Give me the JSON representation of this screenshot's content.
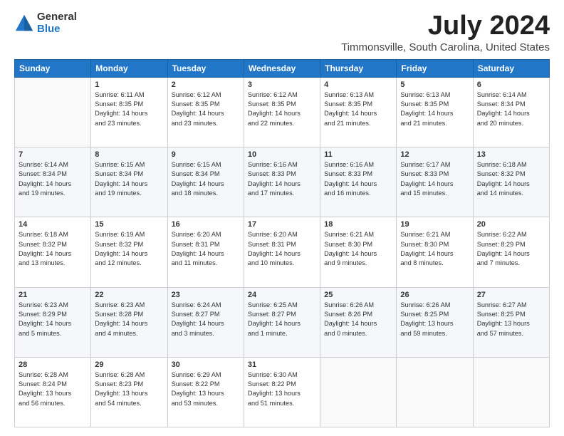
{
  "logo": {
    "general": "General",
    "blue": "Blue"
  },
  "title": "July 2024",
  "subtitle": "Timmonsville, South Carolina, United States",
  "days_header": [
    "Sunday",
    "Monday",
    "Tuesday",
    "Wednesday",
    "Thursday",
    "Friday",
    "Saturday"
  ],
  "weeks": [
    [
      {
        "num": "",
        "info": ""
      },
      {
        "num": "1",
        "info": "Sunrise: 6:11 AM\nSunset: 8:35 PM\nDaylight: 14 hours\nand 23 minutes."
      },
      {
        "num": "2",
        "info": "Sunrise: 6:12 AM\nSunset: 8:35 PM\nDaylight: 14 hours\nand 23 minutes."
      },
      {
        "num": "3",
        "info": "Sunrise: 6:12 AM\nSunset: 8:35 PM\nDaylight: 14 hours\nand 22 minutes."
      },
      {
        "num": "4",
        "info": "Sunrise: 6:13 AM\nSunset: 8:35 PM\nDaylight: 14 hours\nand 21 minutes."
      },
      {
        "num": "5",
        "info": "Sunrise: 6:13 AM\nSunset: 8:35 PM\nDaylight: 14 hours\nand 21 minutes."
      },
      {
        "num": "6",
        "info": "Sunrise: 6:14 AM\nSunset: 8:34 PM\nDaylight: 14 hours\nand 20 minutes."
      }
    ],
    [
      {
        "num": "7",
        "info": "Sunrise: 6:14 AM\nSunset: 8:34 PM\nDaylight: 14 hours\nand 19 minutes."
      },
      {
        "num": "8",
        "info": "Sunrise: 6:15 AM\nSunset: 8:34 PM\nDaylight: 14 hours\nand 19 minutes."
      },
      {
        "num": "9",
        "info": "Sunrise: 6:15 AM\nSunset: 8:34 PM\nDaylight: 14 hours\nand 18 minutes."
      },
      {
        "num": "10",
        "info": "Sunrise: 6:16 AM\nSunset: 8:33 PM\nDaylight: 14 hours\nand 17 minutes."
      },
      {
        "num": "11",
        "info": "Sunrise: 6:16 AM\nSunset: 8:33 PM\nDaylight: 14 hours\nand 16 minutes."
      },
      {
        "num": "12",
        "info": "Sunrise: 6:17 AM\nSunset: 8:33 PM\nDaylight: 14 hours\nand 15 minutes."
      },
      {
        "num": "13",
        "info": "Sunrise: 6:18 AM\nSunset: 8:32 PM\nDaylight: 14 hours\nand 14 minutes."
      }
    ],
    [
      {
        "num": "14",
        "info": "Sunrise: 6:18 AM\nSunset: 8:32 PM\nDaylight: 14 hours\nand 13 minutes."
      },
      {
        "num": "15",
        "info": "Sunrise: 6:19 AM\nSunset: 8:32 PM\nDaylight: 14 hours\nand 12 minutes."
      },
      {
        "num": "16",
        "info": "Sunrise: 6:20 AM\nSunset: 8:31 PM\nDaylight: 14 hours\nand 11 minutes."
      },
      {
        "num": "17",
        "info": "Sunrise: 6:20 AM\nSunset: 8:31 PM\nDaylight: 14 hours\nand 10 minutes."
      },
      {
        "num": "18",
        "info": "Sunrise: 6:21 AM\nSunset: 8:30 PM\nDaylight: 14 hours\nand 9 minutes."
      },
      {
        "num": "19",
        "info": "Sunrise: 6:21 AM\nSunset: 8:30 PM\nDaylight: 14 hours\nand 8 minutes."
      },
      {
        "num": "20",
        "info": "Sunrise: 6:22 AM\nSunset: 8:29 PM\nDaylight: 14 hours\nand 7 minutes."
      }
    ],
    [
      {
        "num": "21",
        "info": "Sunrise: 6:23 AM\nSunset: 8:29 PM\nDaylight: 14 hours\nand 5 minutes."
      },
      {
        "num": "22",
        "info": "Sunrise: 6:23 AM\nSunset: 8:28 PM\nDaylight: 14 hours\nand 4 minutes."
      },
      {
        "num": "23",
        "info": "Sunrise: 6:24 AM\nSunset: 8:27 PM\nDaylight: 14 hours\nand 3 minutes."
      },
      {
        "num": "24",
        "info": "Sunrise: 6:25 AM\nSunset: 8:27 PM\nDaylight: 14 hours\nand 1 minute."
      },
      {
        "num": "25",
        "info": "Sunrise: 6:26 AM\nSunset: 8:26 PM\nDaylight: 14 hours\nand 0 minutes."
      },
      {
        "num": "26",
        "info": "Sunrise: 6:26 AM\nSunset: 8:25 PM\nDaylight: 13 hours\nand 59 minutes."
      },
      {
        "num": "27",
        "info": "Sunrise: 6:27 AM\nSunset: 8:25 PM\nDaylight: 13 hours\nand 57 minutes."
      }
    ],
    [
      {
        "num": "28",
        "info": "Sunrise: 6:28 AM\nSunset: 8:24 PM\nDaylight: 13 hours\nand 56 minutes."
      },
      {
        "num": "29",
        "info": "Sunrise: 6:28 AM\nSunset: 8:23 PM\nDaylight: 13 hours\nand 54 minutes."
      },
      {
        "num": "30",
        "info": "Sunrise: 6:29 AM\nSunset: 8:22 PM\nDaylight: 13 hours\nand 53 minutes."
      },
      {
        "num": "31",
        "info": "Sunrise: 6:30 AM\nSunset: 8:22 PM\nDaylight: 13 hours\nand 51 minutes."
      },
      {
        "num": "",
        "info": ""
      },
      {
        "num": "",
        "info": ""
      },
      {
        "num": "",
        "info": ""
      }
    ]
  ]
}
